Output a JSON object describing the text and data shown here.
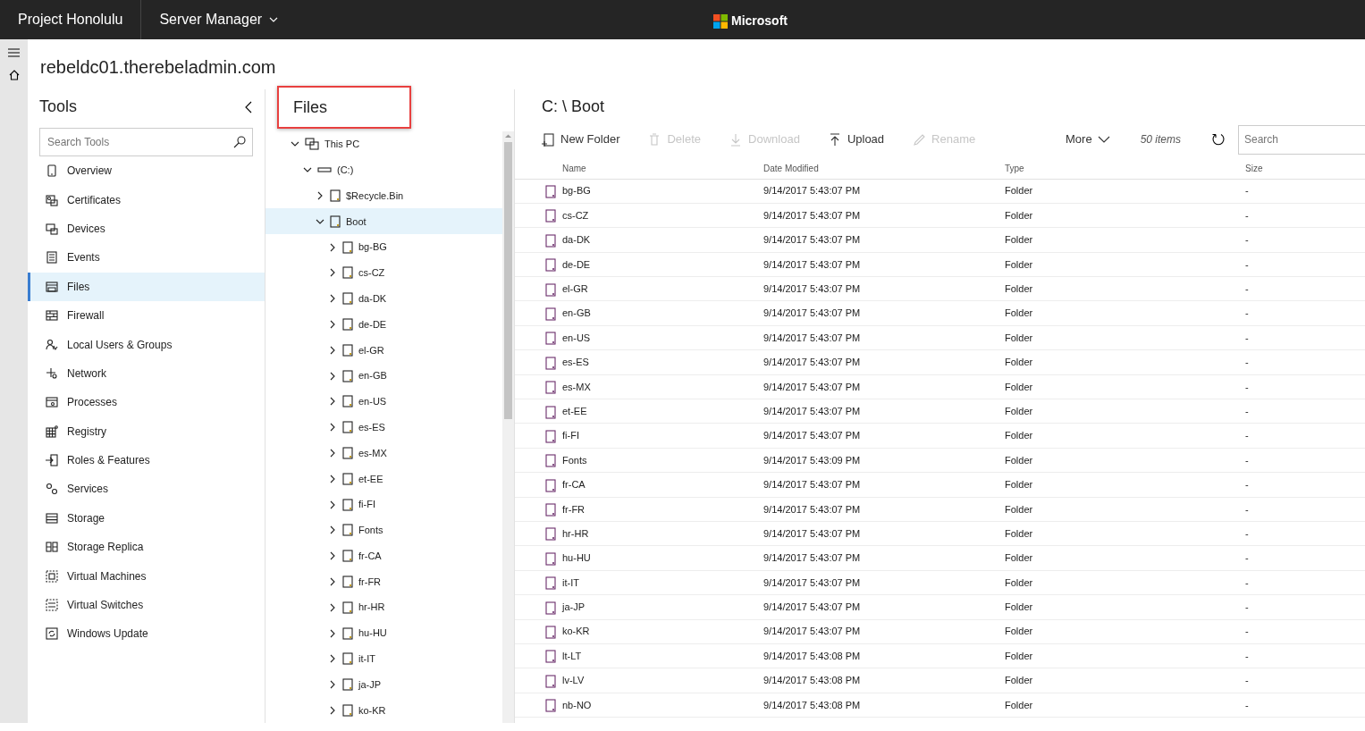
{
  "top_bar": {
    "app_name": "Project Honolulu",
    "menu": "Server Manager",
    "brand": "Microsoft"
  },
  "server_name": "rebeldc01.therebeladmin.com",
  "tools": {
    "title": "Tools",
    "search": {
      "placeholder": "Search Tools"
    },
    "items": [
      {
        "label": "Overview",
        "selected": false
      },
      {
        "label": "Certificates",
        "selected": false
      },
      {
        "label": "Devices",
        "selected": false
      },
      {
        "label": "Events",
        "selected": false
      },
      {
        "label": "Files",
        "selected": true
      },
      {
        "label": "Firewall",
        "selected": false
      },
      {
        "label": "Local Users & Groups",
        "selected": false
      },
      {
        "label": "Network",
        "selected": false
      },
      {
        "label": "Processes",
        "selected": false
      },
      {
        "label": "Registry",
        "selected": false
      },
      {
        "label": "Roles & Features",
        "selected": false
      },
      {
        "label": "Services",
        "selected": false
      },
      {
        "label": "Storage",
        "selected": false
      },
      {
        "label": "Storage Replica",
        "selected": false
      },
      {
        "label": "Virtual Machines",
        "selected": false
      },
      {
        "label": "Virtual Switches",
        "selected": false
      },
      {
        "label": "Windows Update",
        "selected": false
      }
    ]
  },
  "tree_panel": {
    "title": "Files",
    "highlighted": true,
    "nodes": [
      {
        "label": "This PC",
        "kind": "computer",
        "expanded": true,
        "selected": false,
        "children": [
          {
            "label": "(C:)",
            "kind": "drive",
            "expanded": true,
            "selected": false,
            "children": [
              {
                "label": "$Recycle.Bin",
                "kind": "folder",
                "expanded": false,
                "selected": false
              },
              {
                "label": "Boot",
                "kind": "folder",
                "expanded": true,
                "selected": true,
                "children": [
                  {
                    "label": "bg-BG",
                    "kind": "folder",
                    "expanded": false,
                    "selected": false
                  },
                  {
                    "label": "cs-CZ",
                    "kind": "folder",
                    "expanded": false,
                    "selected": false
                  },
                  {
                    "label": "da-DK",
                    "kind": "folder",
                    "expanded": false,
                    "selected": false
                  },
                  {
                    "label": "de-DE",
                    "kind": "folder",
                    "expanded": false,
                    "selected": false
                  },
                  {
                    "label": "el-GR",
                    "kind": "folder",
                    "expanded": false,
                    "selected": false
                  },
                  {
                    "label": "en-GB",
                    "kind": "folder",
                    "expanded": false,
                    "selected": false
                  },
                  {
                    "label": "en-US",
                    "kind": "folder",
                    "expanded": false,
                    "selected": false
                  },
                  {
                    "label": "es-ES",
                    "kind": "folder",
                    "expanded": false,
                    "selected": false
                  },
                  {
                    "label": "es-MX",
                    "kind": "folder",
                    "expanded": false,
                    "selected": false
                  },
                  {
                    "label": "et-EE",
                    "kind": "folder",
                    "expanded": false,
                    "selected": false
                  },
                  {
                    "label": "fi-FI",
                    "kind": "folder",
                    "expanded": false,
                    "selected": false
                  },
                  {
                    "label": "Fonts",
                    "kind": "folder",
                    "expanded": false,
                    "selected": false
                  },
                  {
                    "label": "fr-CA",
                    "kind": "folder",
                    "expanded": false,
                    "selected": false
                  },
                  {
                    "label": "fr-FR",
                    "kind": "folder",
                    "expanded": false,
                    "selected": false
                  },
                  {
                    "label": "hr-HR",
                    "kind": "folder",
                    "expanded": false,
                    "selected": false
                  },
                  {
                    "label": "hu-HU",
                    "kind": "folder",
                    "expanded": false,
                    "selected": false
                  },
                  {
                    "label": "it-IT",
                    "kind": "folder",
                    "expanded": false,
                    "selected": false
                  },
                  {
                    "label": "ja-JP",
                    "kind": "folder",
                    "expanded": false,
                    "selected": false
                  },
                  {
                    "label": "ko-KR",
                    "kind": "folder",
                    "expanded": false,
                    "selected": false
                  }
                ]
              }
            ]
          }
        ]
      }
    ]
  },
  "content": {
    "path": "C: \\ Boot",
    "toolbar": [
      {
        "label": "New Folder",
        "disabled": false
      },
      {
        "label": "Delete",
        "disabled": true
      },
      {
        "label": "Download",
        "disabled": true
      },
      {
        "label": "Upload",
        "disabled": false
      },
      {
        "label": "Rename",
        "disabled": true
      }
    ],
    "more": "More",
    "item_count": "50 items",
    "search": {
      "placeholder": "Search"
    },
    "table": {
      "columns": [
        "Name",
        "Date Modified",
        "Type",
        "Size"
      ],
      "rows": [
        {
          "name": "bg-BG",
          "date_modified": "9/14/2017 5:43:07 PM",
          "type": "Folder",
          "size": "-"
        },
        {
          "name": "cs-CZ",
          "date_modified": "9/14/2017 5:43:07 PM",
          "type": "Folder",
          "size": "-"
        },
        {
          "name": "da-DK",
          "date_modified": "9/14/2017 5:43:07 PM",
          "type": "Folder",
          "size": "-"
        },
        {
          "name": "de-DE",
          "date_modified": "9/14/2017 5:43:07 PM",
          "type": "Folder",
          "size": "-"
        },
        {
          "name": "el-GR",
          "date_modified": "9/14/2017 5:43:07 PM",
          "type": "Folder",
          "size": "-"
        },
        {
          "name": "en-GB",
          "date_modified": "9/14/2017 5:43:07 PM",
          "type": "Folder",
          "size": "-"
        },
        {
          "name": "en-US",
          "date_modified": "9/14/2017 5:43:07 PM",
          "type": "Folder",
          "size": "-"
        },
        {
          "name": "es-ES",
          "date_modified": "9/14/2017 5:43:07 PM",
          "type": "Folder",
          "size": "-"
        },
        {
          "name": "es-MX",
          "date_modified": "9/14/2017 5:43:07 PM",
          "type": "Folder",
          "size": "-"
        },
        {
          "name": "et-EE",
          "date_modified": "9/14/2017 5:43:07 PM",
          "type": "Folder",
          "size": "-"
        },
        {
          "name": "fi-FI",
          "date_modified": "9/14/2017 5:43:07 PM",
          "type": "Folder",
          "size": "-"
        },
        {
          "name": "Fonts",
          "date_modified": "9/14/2017 5:43:09 PM",
          "type": "Folder",
          "size": "-"
        },
        {
          "name": "fr-CA",
          "date_modified": "9/14/2017 5:43:07 PM",
          "type": "Folder",
          "size": "-"
        },
        {
          "name": "fr-FR",
          "date_modified": "9/14/2017 5:43:07 PM",
          "type": "Folder",
          "size": "-"
        },
        {
          "name": "hr-HR",
          "date_modified": "9/14/2017 5:43:07 PM",
          "type": "Folder",
          "size": "-"
        },
        {
          "name": "hu-HU",
          "date_modified": "9/14/2017 5:43:07 PM",
          "type": "Folder",
          "size": "-"
        },
        {
          "name": "it-IT",
          "date_modified": "9/14/2017 5:43:07 PM",
          "type": "Folder",
          "size": "-"
        },
        {
          "name": "ja-JP",
          "date_modified": "9/14/2017 5:43:07 PM",
          "type": "Folder",
          "size": "-"
        },
        {
          "name": "ko-KR",
          "date_modified": "9/14/2017 5:43:07 PM",
          "type": "Folder",
          "size": "-"
        },
        {
          "name": "lt-LT",
          "date_modified": "9/14/2017 5:43:08 PM",
          "type": "Folder",
          "size": "-"
        },
        {
          "name": "lv-LV",
          "date_modified": "9/14/2017 5:43:08 PM",
          "type": "Folder",
          "size": "-"
        },
        {
          "name": "nb-NO",
          "date_modified": "9/14/2017 5:43:08 PM",
          "type": "Folder",
          "size": "-"
        }
      ]
    }
  }
}
